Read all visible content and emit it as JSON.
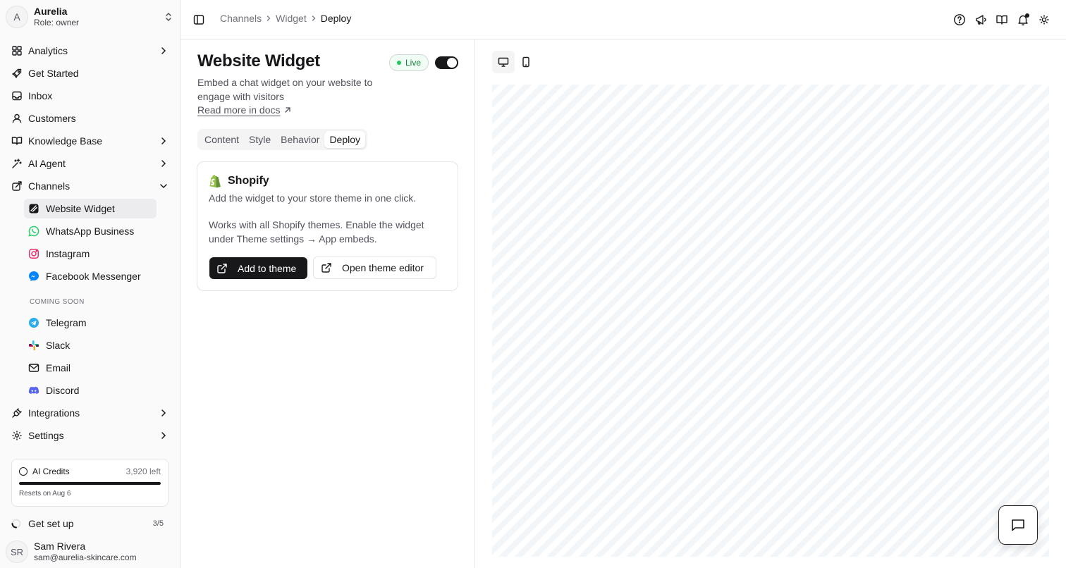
{
  "org": {
    "avatar": "A",
    "name": "Aurelia",
    "role": "Role: owner"
  },
  "sidebar": {
    "items": [
      {
        "label": "Analytics",
        "icon": "grid-icon"
      },
      {
        "label": "Get Started",
        "icon": "rocket-icon"
      },
      {
        "label": "Inbox",
        "icon": "inbox-icon"
      },
      {
        "label": "Customers",
        "icon": "user-icon"
      },
      {
        "label": "Knowledge Base",
        "icon": "book-icon"
      },
      {
        "label": "AI Agent",
        "icon": "sparkles-icon"
      },
      {
        "label": "Channels",
        "icon": "channels-icon"
      }
    ],
    "channels": [
      {
        "label": "Website Widget",
        "icon": "widget-icon"
      },
      {
        "label": "WhatsApp Business",
        "icon": "whatsapp-icon"
      },
      {
        "label": "Instagram",
        "icon": "instagram-icon"
      },
      {
        "label": "Facebook Messenger",
        "icon": "messenger-icon"
      }
    ],
    "coming_soon_label": "Coming soon",
    "coming_soon": [
      {
        "label": "Telegram",
        "icon": "telegram-icon"
      },
      {
        "label": "Slack",
        "icon": "slack-icon"
      },
      {
        "label": "Email",
        "icon": "mail-icon"
      },
      {
        "label": "Discord",
        "icon": "discord-icon"
      }
    ],
    "bottom_items": [
      {
        "label": "Integrations",
        "icon": "plug-icon"
      },
      {
        "label": "Settings",
        "icon": "gear-icon"
      }
    ],
    "credits": {
      "title": "AI Credits",
      "left": "3,920 left",
      "used_fraction": 1.0,
      "reset": "Resets on Aug 6"
    },
    "setup": {
      "label": "Get set up",
      "count": "3/5"
    },
    "user": {
      "avatar": "SR",
      "name": "Sam Rivera",
      "email": "sam@aurelia-skincare.com"
    }
  },
  "header": {
    "breadcrumbs": [
      "Channels",
      "Widget",
      "Deploy"
    ]
  },
  "main": {
    "title": "Website Widget",
    "status_badge": "Live",
    "enabled": true,
    "description": "Embed a chat widget on your website to engage with visitors",
    "docs_link": "Read more in docs",
    "tabs": [
      {
        "label": "Content",
        "active": false
      },
      {
        "label": "Style",
        "active": false
      },
      {
        "label": "Behavior",
        "active": false
      },
      {
        "label": "Deploy",
        "active": true
      }
    ],
    "card": {
      "title": "Shopify",
      "line1": "Add the widget to your store theme in one click.",
      "line2": "Works with all Shopify themes. Enable the widget under Theme settings → App embeds.",
      "primary_button": "Add to theme",
      "secondary_button": "Open theme editor"
    }
  },
  "colors": {
    "accent": "#18181b",
    "live": "#22c55e",
    "whatsapp": "#25D366",
    "instagram": "#E1306C",
    "messenger": "#0084FF",
    "telegram": "#2AABEE",
    "discord": "#5865F2",
    "shopify": "#95BF47"
  }
}
